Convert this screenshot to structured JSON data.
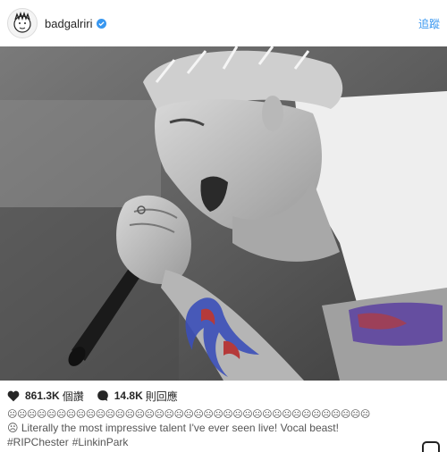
{
  "header": {
    "username": "badgalriri",
    "follow_label": "追蹤"
  },
  "photo": {
    "description_icon": "concert-singer-photo"
  },
  "actions": {
    "likes_count": "861.3K",
    "likes_label": "個讚",
    "comments_count": "14.8K",
    "comments_label": "則回應"
  },
  "caption": {
    "emoji_row": "☹☹☹☹☹☹☹☹☹☹☹☹☹☹☹☹☹☹☹☹☹☹☹☹☹☹☹☹☹☹☹☹☹☹☹☹☹",
    "text": "☹ Literally the most impressive talent I've ever seen live! Vocal beast!",
    "hashtags": [
      "#RIPChester",
      "#LinkinPark"
    ]
  },
  "colors": {
    "accent": "#3897f0",
    "tattoo_red": "#b53a3a",
    "tattoo_blue": "#3b4fb8"
  }
}
